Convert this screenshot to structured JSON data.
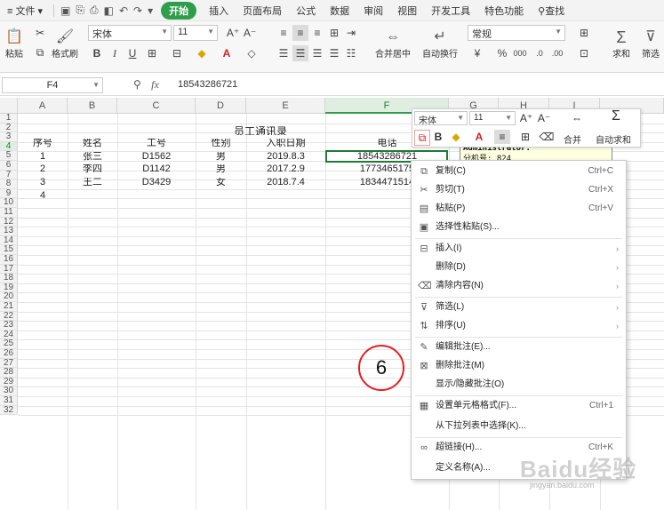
{
  "menubar": {
    "file": "文件",
    "items": [
      "开始",
      "插入",
      "页面布局",
      "公式",
      "数据",
      "审阅",
      "视图",
      "开发工具",
      "特色功能"
    ],
    "search": "查找"
  },
  "ribbon": {
    "paste": "粘贴",
    "format_painter": "格式刷",
    "font_name": "宋体",
    "font_size": "11",
    "merge_center": "合并居中",
    "wrap_text": "自动换行",
    "number_format": "常规",
    "sum": "求和",
    "filter": "筛选"
  },
  "formula": {
    "cell_ref": "F4",
    "fx": "fx",
    "value": "18543286721"
  },
  "columns": [
    "A",
    "B",
    "C",
    "D",
    "E",
    "F",
    "G",
    "H",
    "I"
  ],
  "rows": [
    "1",
    "2",
    "3",
    "4",
    "5",
    "6",
    "7",
    "8",
    "9",
    "10",
    "11",
    "12",
    "13",
    "14",
    "15",
    "16",
    "17",
    "18",
    "19",
    "20",
    "21",
    "22",
    "23",
    "24",
    "25",
    "26",
    "27",
    "28",
    "29",
    "30",
    "31",
    "32"
  ],
  "sheet": {
    "title": "员工通讯录",
    "headers": [
      "序号",
      "姓名",
      "工号",
      "性别",
      "入职日期",
      "电话"
    ],
    "records": [
      [
        "1",
        "张三",
        "D1562",
        "男",
        "2019.8.3",
        "18543286721"
      ],
      [
        "2",
        "李四",
        "D1142",
        "男",
        "2017.2.9",
        "1773465175"
      ],
      [
        "3",
        "王二",
        "D3429",
        "女",
        "2018.7.4",
        "1834471514"
      ]
    ],
    "row7_a": "4"
  },
  "comment": {
    "author": "Administrator:",
    "text": "分机号: 824"
  },
  "mini_toolbar": {
    "font_name": "宋体",
    "font_size": "11",
    "merge": "合并",
    "autosum": "自动求和"
  },
  "context_menu": [
    {
      "label": "复制(C)",
      "shortcut": "Ctrl+C",
      "icon": "copy-icon"
    },
    {
      "label": "剪切(T)",
      "shortcut": "Ctrl+X",
      "icon": "scissors-icon"
    },
    {
      "label": "粘贴(P)",
      "shortcut": "Ctrl+V",
      "icon": "paste-icon"
    },
    {
      "label": "选择性粘贴(S)...",
      "shortcut": "",
      "icon": "paste-special-icon"
    },
    {
      "label": "插入(I)",
      "shortcut": "",
      "icon": "insert-icon"
    },
    {
      "label": "删除(D)",
      "shortcut": "",
      "icon": ""
    },
    {
      "label": "清除内容(N)",
      "shortcut": "",
      "icon": "eraser-icon"
    },
    {
      "label": "筛选(L)",
      "shortcut": "",
      "icon": "filter-icon"
    },
    {
      "label": "排序(U)",
      "shortcut": "",
      "icon": "sort-icon"
    },
    {
      "label": "编辑批注(E)...",
      "shortcut": "",
      "icon": "edit-comment-icon"
    },
    {
      "label": "删除批注(M)",
      "shortcut": "",
      "icon": "delete-comment-icon"
    },
    {
      "label": "显示/隐藏批注(O)",
      "shortcut": "",
      "icon": ""
    },
    {
      "label": "设置单元格格式(F)...",
      "shortcut": "Ctrl+1",
      "icon": "format-cells-icon"
    },
    {
      "label": "从下拉列表中选择(K)...",
      "shortcut": "",
      "icon": ""
    },
    {
      "label": "超链接(H)...",
      "shortcut": "Ctrl+K",
      "icon": "hyperlink-icon"
    },
    {
      "label": "定义名称(A)...",
      "shortcut": "",
      "icon": ""
    }
  ],
  "step_number": "6",
  "watermark": {
    "main": "Baidu经验",
    "url": "jingyan.baidu.com"
  },
  "colors": {
    "accent": "#2e9e4d",
    "selection": "#1e7a35",
    "annotation": "#e02020",
    "comment_bg": "#ffffe1"
  }
}
